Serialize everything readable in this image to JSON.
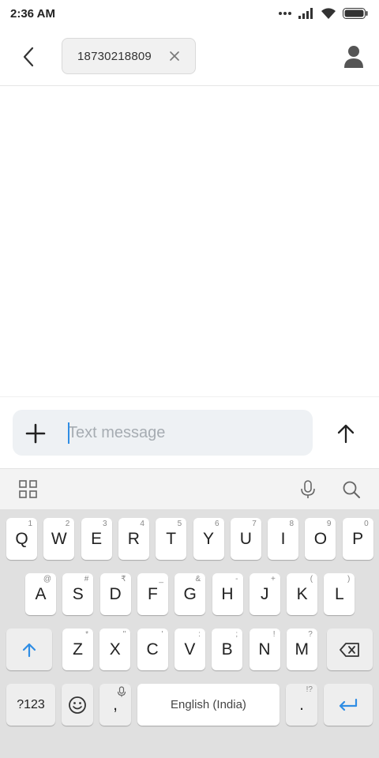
{
  "status_bar": {
    "time": "2:36 AM",
    "icons": [
      "more-dots-icon",
      "signal-icon",
      "wifi-icon",
      "battery-icon"
    ]
  },
  "header": {
    "recipient": "18730218809",
    "icons": [
      "back-arrow-icon",
      "close-icon",
      "contact-person-icon"
    ]
  },
  "composer": {
    "placeholder": "Text message",
    "value": "",
    "icons": [
      "plus-icon",
      "send-arrow-up-icon"
    ]
  },
  "keyboard_toolbar": {
    "icons": [
      "grid-icon",
      "microphone-icon",
      "search-icon"
    ]
  },
  "keyboard": {
    "row1": [
      {
        "k": "Q",
        "h": "1"
      },
      {
        "k": "W",
        "h": "2"
      },
      {
        "k": "E",
        "h": "3"
      },
      {
        "k": "R",
        "h": "4"
      },
      {
        "k": "T",
        "h": "5"
      },
      {
        "k": "Y",
        "h": "6"
      },
      {
        "k": "U",
        "h": "7"
      },
      {
        "k": "I",
        "h": "8"
      },
      {
        "k": "O",
        "h": "9"
      },
      {
        "k": "P",
        "h": "0"
      }
    ],
    "row2": [
      {
        "k": "A",
        "h": "@"
      },
      {
        "k": "S",
        "h": "#"
      },
      {
        "k": "D",
        "h": "₹"
      },
      {
        "k": "F",
        "h": "_"
      },
      {
        "k": "G",
        "h": "&"
      },
      {
        "k": "H",
        "h": "-"
      },
      {
        "k": "J",
        "h": "+"
      },
      {
        "k": "K",
        "h": "("
      },
      {
        "k": "L",
        "h": ")"
      }
    ],
    "row3": [
      {
        "k": "Z",
        "h": "*"
      },
      {
        "k": "X",
        "h": "\""
      },
      {
        "k": "C",
        "h": "'"
      },
      {
        "k": "V",
        "h": ":"
      },
      {
        "k": "B",
        "h": ";"
      },
      {
        "k": "N",
        "h": "!"
      },
      {
        "k": "M",
        "h": "?"
      }
    ],
    "symbols_label": "?123",
    "comma": ",",
    "space_label": "English (India)",
    "period": ".",
    "period_hint": "!?",
    "accent_color": "#2f8de4"
  }
}
